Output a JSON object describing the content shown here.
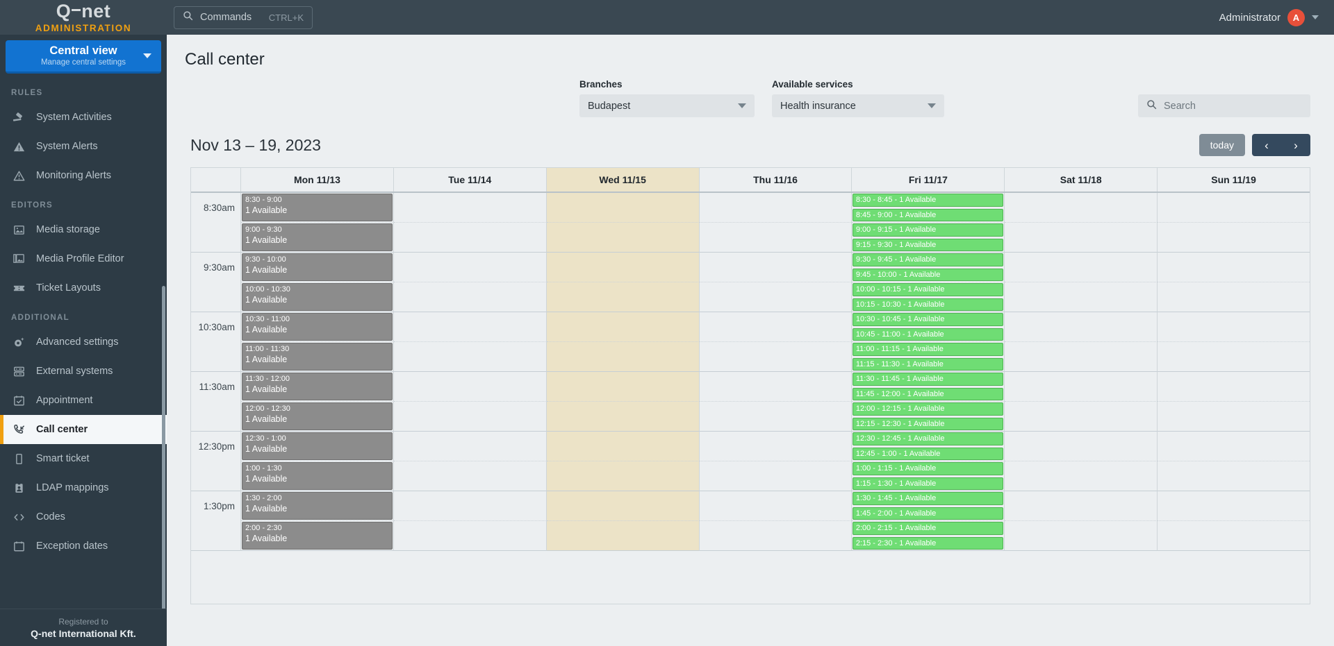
{
  "brand": {
    "name": "Q-net",
    "subtitle": "ADMINISTRATION",
    "accent_orange": "#f0a011",
    "accent_blue": "#1273d1"
  },
  "topbar": {
    "commands_label": "Commands",
    "commands_shortcut": "CTRL+K",
    "search_icon": "search-icon",
    "user_name": "Administrator",
    "avatar_initial": "A",
    "avatar_color": "#e8503a",
    "caret_icon": "chevron-down-icon"
  },
  "view_switcher": {
    "title": "Central view",
    "subtitle": "Manage central settings",
    "caret_icon": "chevron-down-icon"
  },
  "sidebar": {
    "groups": [
      {
        "label": "RULES",
        "items": [
          {
            "label": "System Activities",
            "icon": "gavel-icon",
            "active": false
          },
          {
            "label": "System Alerts",
            "icon": "warning-triangle-icon",
            "active": false
          },
          {
            "label": "Monitoring Alerts",
            "icon": "alert-triangle-outline-icon",
            "active": false
          }
        ]
      },
      {
        "label": "EDITORS",
        "items": [
          {
            "label": "Media storage",
            "icon": "image-icon",
            "active": false
          },
          {
            "label": "Media Profile Editor",
            "icon": "images-stack-icon",
            "active": false
          },
          {
            "label": "Ticket Layouts",
            "icon": "ticket-icon",
            "active": false
          }
        ]
      },
      {
        "label": "ADDITIONAL",
        "items": [
          {
            "label": "Advanced settings",
            "icon": "gear-sparkle-icon",
            "active": false
          },
          {
            "label": "External systems",
            "icon": "server-icon",
            "active": false
          },
          {
            "label": "Appointment",
            "icon": "calendar-check-icon",
            "active": false
          },
          {
            "label": "Call center",
            "icon": "phone-incoming-icon",
            "active": true
          },
          {
            "label": "Smart ticket",
            "icon": "mobile-icon",
            "active": false
          },
          {
            "label": "LDAP mappings",
            "icon": "id-badge-icon",
            "active": false
          },
          {
            "label": "Codes",
            "icon": "code-icon",
            "active": false
          },
          {
            "label": "Exception dates",
            "icon": "calendar-x-icon",
            "active": false
          }
        ]
      }
    ],
    "footer": {
      "registered_label": "Registered to",
      "company": "Q-net International Kft."
    }
  },
  "page": {
    "title": "Call center"
  },
  "filters": {
    "branches": {
      "label": "Branches",
      "value": "Budapest",
      "caret_icon": "chevron-down-icon"
    },
    "services": {
      "label": "Available services",
      "value": "Health insurance",
      "caret_icon": "chevron-down-icon"
    },
    "search": {
      "placeholder": "Search",
      "value": "",
      "icon": "search-icon",
      "caret_icon": "chevron-down-icon"
    }
  },
  "calendar": {
    "range_label": "Nov 13 – 19, 2023",
    "today_label": "today",
    "prev_icon": "chevron-left-icon",
    "next_icon": "chevron-right-icon",
    "day_headers": [
      {
        "label": "Mon 11/13",
        "tinted": false
      },
      {
        "label": "Tue 11/14",
        "tinted": false
      },
      {
        "label": "Wed 11/15",
        "tinted": true
      },
      {
        "label": "Thu 11/16",
        "tinted": false
      },
      {
        "label": "Fri 11/17",
        "tinted": false
      },
      {
        "label": "Sat 11/18",
        "tinted": false
      },
      {
        "label": "Sun 11/19",
        "tinted": false
      }
    ],
    "gutter_labels": [
      "8:30am",
      "",
      "9:30am",
      "",
      "10:30am",
      "",
      "11:30am",
      "",
      "12:30pm",
      "",
      "1:30pm",
      ""
    ],
    "availability_text": "1 Available",
    "colors": {
      "busy": "#8c8c8c",
      "free": "#6fdd74",
      "tinted_day": "#ece3c7"
    },
    "events": {
      "monday": [
        {
          "time": "8:30 - 9:00",
          "avail": "1 Available"
        },
        {
          "time": "9:00 - 9:30",
          "avail": "1 Available"
        },
        {
          "time": "9:30 - 10:00",
          "avail": "1 Available"
        },
        {
          "time": "10:00 - 10:30",
          "avail": "1 Available"
        },
        {
          "time": "10:30 - 11:00",
          "avail": "1 Available"
        },
        {
          "time": "11:00 - 11:30",
          "avail": "1 Available"
        },
        {
          "time": "11:30 - 12:00",
          "avail": "1 Available"
        },
        {
          "time": "12:00 - 12:30",
          "avail": "1 Available"
        },
        {
          "time": "12:30 - 1:00",
          "avail": "1 Available"
        },
        {
          "time": "1:00 - 1:30",
          "avail": "1 Available"
        },
        {
          "time": "1:30 - 2:00",
          "avail": "1 Available"
        },
        {
          "time": "2:00 - 2:30",
          "avail": "1 Available"
        }
      ],
      "friday": [
        {
          "label": "8:30 - 8:45 - 1 Available"
        },
        {
          "label": "8:45 - 9:00 - 1 Available"
        },
        {
          "label": "9:00 - 9:15 - 1 Available"
        },
        {
          "label": "9:15 - 9:30 - 1 Available"
        },
        {
          "label": "9:30 - 9:45 - 1 Available"
        },
        {
          "label": "9:45 - 10:00 - 1 Available"
        },
        {
          "label": "10:00 - 10:15 - 1 Available"
        },
        {
          "label": "10:15 - 10:30 - 1 Available"
        },
        {
          "label": "10:30 - 10:45 - 1 Available"
        },
        {
          "label": "10:45 - 11:00 - 1 Available"
        },
        {
          "label": "11:00 - 11:15 - 1 Available"
        },
        {
          "label": "11:15 - 11:30 - 1 Available"
        },
        {
          "label": "11:30 - 11:45 - 1 Available"
        },
        {
          "label": "11:45 - 12:00 - 1 Available"
        },
        {
          "label": "12:00 - 12:15 - 1 Available"
        },
        {
          "label": "12:15 - 12:30 - 1 Available"
        },
        {
          "label": "12:30 - 12:45 - 1 Available"
        },
        {
          "label": "12:45 - 1:00 - 1 Available"
        },
        {
          "label": "1:00 - 1:15 - 1 Available"
        },
        {
          "label": "1:15 - 1:30 - 1 Available"
        },
        {
          "label": "1:30 - 1:45 - 1 Available"
        },
        {
          "label": "1:45 - 2:00 - 1 Available"
        },
        {
          "label": "2:00 - 2:15 - 1 Available"
        },
        {
          "label": "2:15 - 2:30 - 1 Available"
        }
      ]
    }
  }
}
